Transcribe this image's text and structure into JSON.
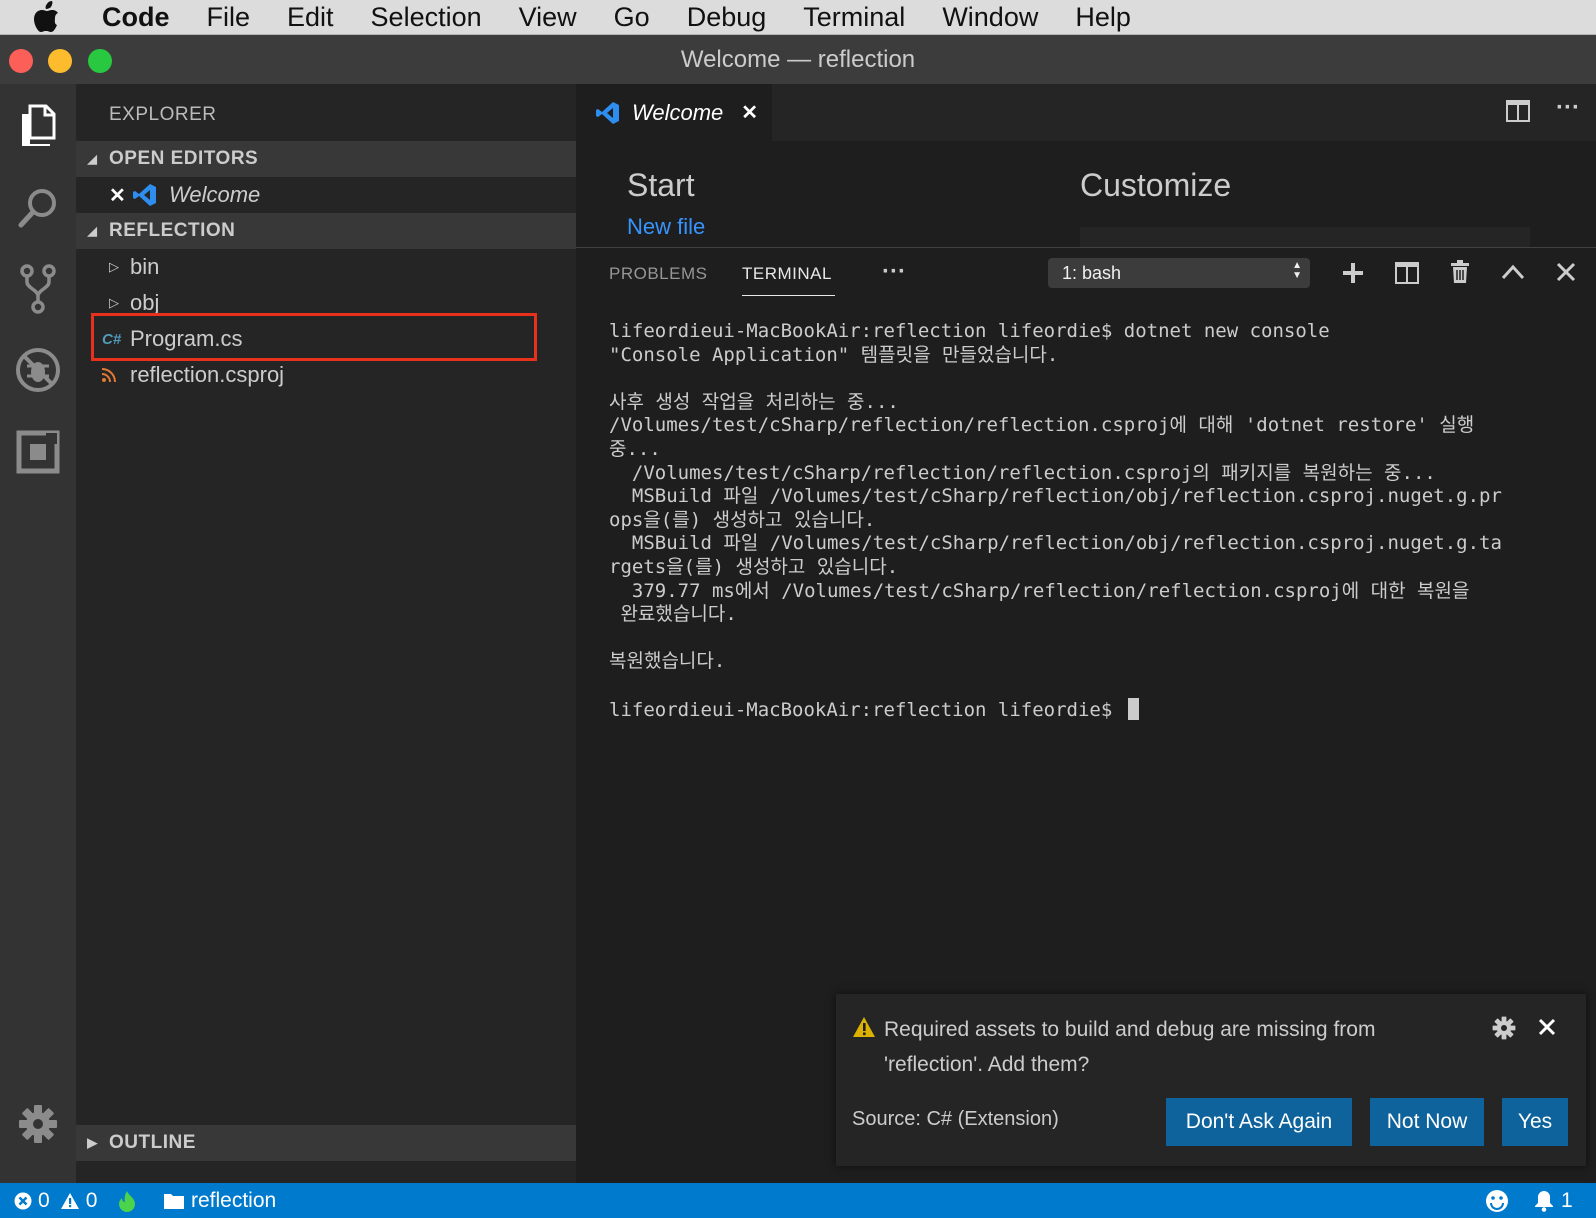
{
  "menubar": {
    "app_name": "Code",
    "items": [
      "File",
      "Edit",
      "Selection",
      "View",
      "Go",
      "Debug",
      "Terminal",
      "Window",
      "Help"
    ]
  },
  "window": {
    "title": "Welcome — reflection"
  },
  "sidebar": {
    "title": "EXPLORER",
    "open_editors": {
      "label": "OPEN EDITORS",
      "items": [
        {
          "label": "Welcome"
        }
      ]
    },
    "folder": {
      "label": "REFLECTION",
      "items": [
        {
          "label": "bin",
          "type": "folder"
        },
        {
          "label": "obj",
          "type": "folder"
        },
        {
          "label": "Program.cs",
          "type": "csharp",
          "highlighted": true
        },
        {
          "label": "reflection.csproj",
          "type": "rss"
        }
      ]
    },
    "outline": {
      "label": "OUTLINE"
    }
  },
  "tabs": [
    {
      "label": "Welcome",
      "active": true
    }
  ],
  "welcome": {
    "start_heading": "Start",
    "new_file_link": "New file",
    "customize_heading": "Customize"
  },
  "panel": {
    "tabs": [
      {
        "label": "PROBLEMS",
        "active": false
      },
      {
        "label": "TERMINAL",
        "active": true
      }
    ],
    "more_label": "···",
    "terminal_select": "1: bash",
    "terminal_lines": [
      "lifeordieui-MacBookAir:reflection lifeordie$ dotnet new console",
      "\"Console Application\" 템플릿을 만들었습니다.",
      "",
      "사후 생성 작업을 처리하는 중...",
      "/Volumes/test/cSharp/reflection/reflection.csproj에 대해 'dotnet restore' 실행",
      "중...",
      "  /Volumes/test/cSharp/reflection/reflection.csproj의 패키지를 복원하는 중...",
      "  MSBuild 파일 /Volumes/test/cSharp/reflection/obj/reflection.csproj.nuget.g.pr",
      "ops을(를) 생성하고 있습니다.",
      "  MSBuild 파일 /Volumes/test/cSharp/reflection/obj/reflection.csproj.nuget.g.ta",
      "rgets을(를) 생성하고 있습니다.",
      "  379.77 ms에서 /Volumes/test/cSharp/reflection/reflection.csproj에 대한 복원을",
      " 완료했습니다.",
      "",
      "복원했습니다.",
      "",
      "lifeordieui-MacBookAir:reflection lifeordie$ "
    ]
  },
  "notification": {
    "message_line1": "Required assets to build and debug are missing from",
    "message_line2": "'reflection'. Add them?",
    "source": "Source: C# (Extension)",
    "buttons": {
      "dont_ask": "Don't Ask Again",
      "not_now": "Not Now",
      "yes": "Yes"
    }
  },
  "statusbar": {
    "errors": "0",
    "warnings": "0",
    "folder": "reflection",
    "notifications": "1"
  },
  "colors": {
    "accent": "#007acc",
    "button": "#0e639c",
    "highlight_box": "#e8311c",
    "link": "#3794ff"
  }
}
